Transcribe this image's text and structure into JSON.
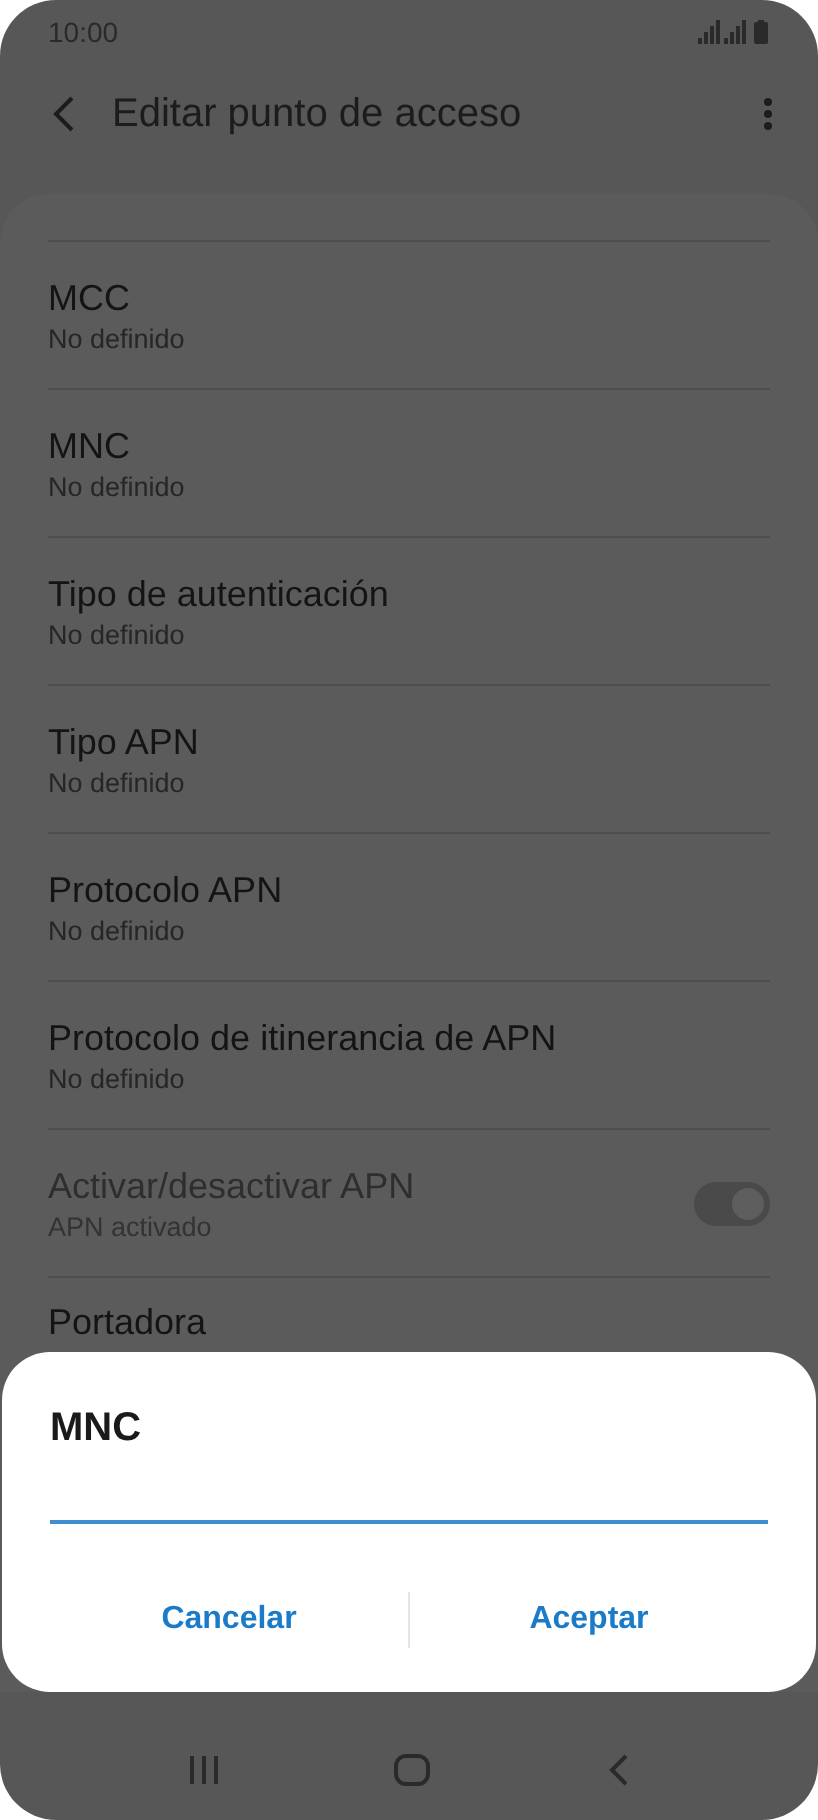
{
  "status_bar": {
    "time": "10:00"
  },
  "header": {
    "title": "Editar punto de acceso"
  },
  "rows": [
    {
      "kind": "text",
      "title": "MCC",
      "subtitle": "No definido",
      "disabled": false
    },
    {
      "kind": "text",
      "title": "MNC",
      "subtitle": "No definido",
      "disabled": false
    },
    {
      "kind": "text",
      "title": "Tipo de autenticación",
      "subtitle": "No definido",
      "disabled": false
    },
    {
      "kind": "text",
      "title": "Tipo APN",
      "subtitle": "No definido",
      "disabled": false
    },
    {
      "kind": "text",
      "title": "Protocolo APN",
      "subtitle": "No definido",
      "disabled": false
    },
    {
      "kind": "text",
      "title": "Protocolo de itinerancia de APN",
      "subtitle": "No definido",
      "disabled": false
    },
    {
      "kind": "toggle",
      "title": "Activar/desactivar APN",
      "subtitle": "APN activado",
      "disabled": true,
      "on": true
    },
    {
      "kind": "text",
      "title": "Portadora",
      "disabled": false
    }
  ],
  "dialog": {
    "title": "MNC",
    "buttons": [
      "Cancelar",
      "Aceptar"
    ]
  }
}
